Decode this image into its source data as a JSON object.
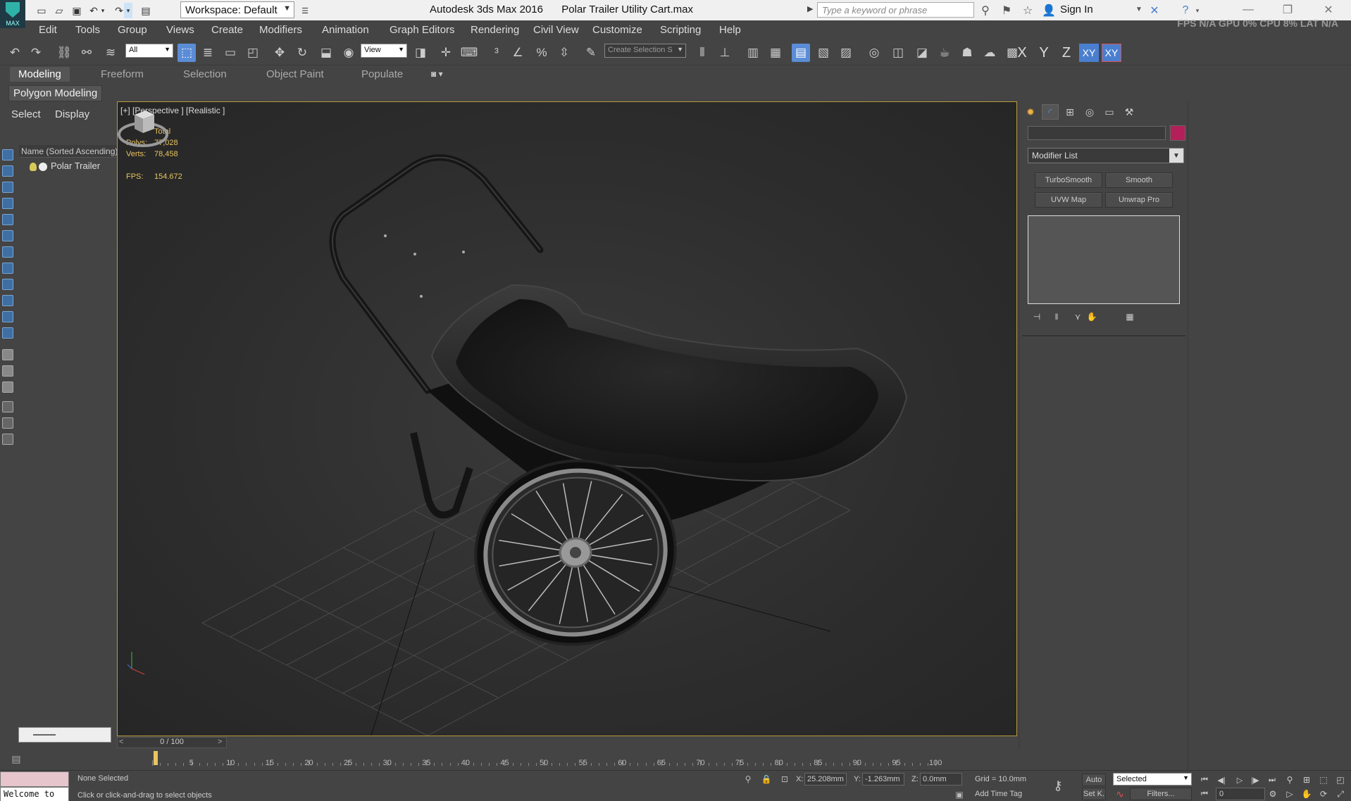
{
  "titlebar": {
    "logo_text": "MAX",
    "workspace": "Workspace: Default",
    "app_title": "Autodesk 3ds Max 2016",
    "file_title": "Polar Trailer Utility Cart.max",
    "search_placeholder": "Type a keyword or phrase",
    "signin": "Sign In"
  },
  "menu": {
    "items": [
      "Edit",
      "Tools",
      "Group",
      "Views",
      "Create",
      "Modifiers",
      "Animation",
      "Graph Editors",
      "Rendering",
      "Civil View",
      "Customize",
      "Scripting",
      "Help"
    ],
    "stats_text": "FPS  N/A  GPU  0%  CPU  8%  LAT  N/A"
  },
  "toolbar": {
    "selection_filter": "All",
    "ref_coord": "View",
    "named_selection": "Create Selection S",
    "axes": [
      "X",
      "Y",
      "Z",
      "XY",
      "XY"
    ]
  },
  "ribbon": {
    "tabs": [
      "Modeling",
      "Freeform",
      "Selection",
      "Object Paint",
      "Populate"
    ],
    "active_tab": "Modeling",
    "sub_button": "Polygon Modeling"
  },
  "explorer": {
    "tab_select": "Select",
    "tab_display": "Display",
    "header": "Name (Sorted Ascending)",
    "items": [
      "Polar Trailer"
    ]
  },
  "viewport": {
    "label": "[+] [Perspective ] [Realistic ]",
    "stats": {
      "total_label": "Total",
      "polys_label": "Polys:",
      "polys": "77,028",
      "verts_label": "Verts:",
      "verts": "78,458",
      "fps_label": "FPS:",
      "fps": "154.672"
    }
  },
  "command_panel": {
    "object_color": "#b21f59",
    "modifier_list": "Modifier List",
    "modifier_buttons": [
      "TurboSmooth",
      "Smooth",
      "UVW Map",
      "Unwrap Pro"
    ]
  },
  "timeline": {
    "slider": "0 / 100",
    "ticks": [
      "5",
      "10",
      "15",
      "20",
      "25",
      "30",
      "35",
      "40",
      "45",
      "50",
      "55",
      "60",
      "65",
      "70",
      "75",
      "80",
      "85",
      "90",
      "95",
      "100"
    ]
  },
  "status": {
    "maxscript": "Welcome to",
    "selection": "None Selected",
    "prompt": "Click or click-and-drag to select objects",
    "x_label": "X:",
    "x": "25.208mm",
    "y_label": "Y:",
    "y": "-1.263mm",
    "z_label": "Z:",
    "z": "0.0mm",
    "grid": "Grid = 10.0mm",
    "add_time_tag": "Add Time Tag",
    "auto": "Auto",
    "set_key": "Set K.",
    "key_filter": "Selected",
    "filters": "Filters...",
    "frame": "0"
  }
}
